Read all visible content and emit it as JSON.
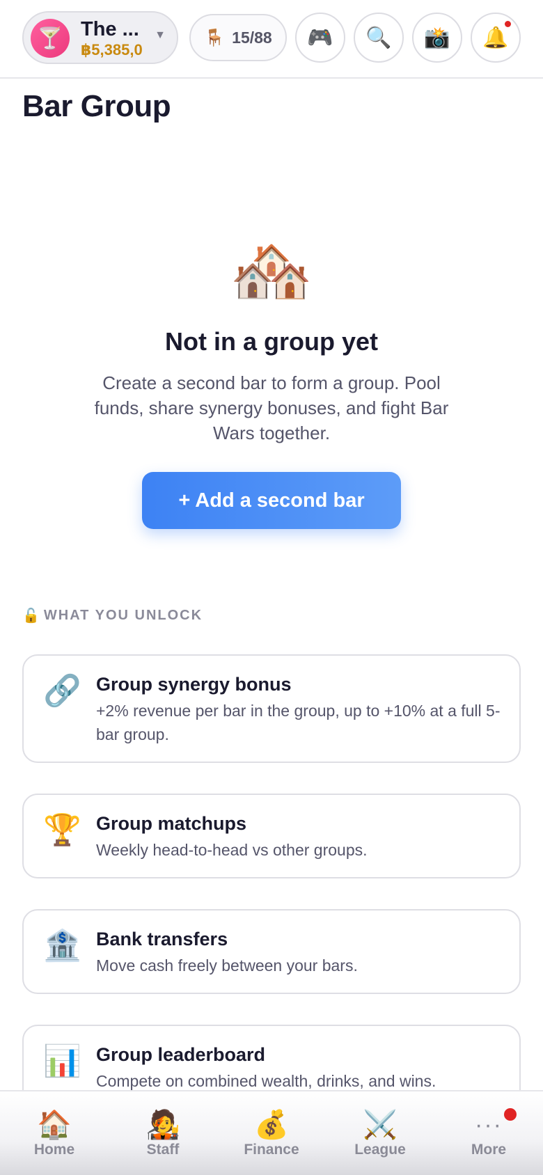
{
  "header": {
    "bar_name": "The ...",
    "bar_cash": "฿5,385,0",
    "bar_avatar_icon": "cocktail-icon",
    "seats": "15/88",
    "seats_icon": "chair-icon",
    "buttons": [
      "gamepad-icon",
      "search-icon",
      "camera-flash-icon",
      "bell-icon"
    ]
  },
  "page": {
    "title": "Bar Group"
  },
  "empty_state": {
    "icon": "🏘️",
    "title": "Not in a group yet",
    "description": "Create a second bar to form a group. Pool funds, share synergy bonuses, and fight Bar Wars together.",
    "button_label": "+ Add a second bar"
  },
  "unlock": {
    "label": "WHAT YOU UNLOCK",
    "items": [
      {
        "icon": "🔗",
        "title": "Group synergy bonus",
        "description": "+2% revenue per bar in the group, up to +10% at a full 5-bar group."
      },
      {
        "icon": "🏆",
        "title": "Group matchups",
        "description": "Weekly head-to-head vs other groups."
      },
      {
        "icon": "🏦",
        "title": "Bank transfers",
        "description": "Move cash freely between your bars."
      },
      {
        "icon": "📊",
        "title": "Group leaderboard",
        "description": "Compete on combined wealth, drinks, and wins."
      }
    ]
  },
  "nav": {
    "items": [
      {
        "icon": "🏠",
        "label": "Home"
      },
      {
        "icon": "🧑‍🎤",
        "label": "Staff"
      },
      {
        "icon": "💰",
        "label": "Finance"
      },
      {
        "icon": "⚔️",
        "label": "League"
      },
      {
        "icon": "···",
        "label": "More"
      }
    ]
  },
  "colors": {
    "accent": "#3d82f4",
    "cash": "#c98a10",
    "avatar": "#ec3a7d",
    "notification": "#e02424"
  }
}
